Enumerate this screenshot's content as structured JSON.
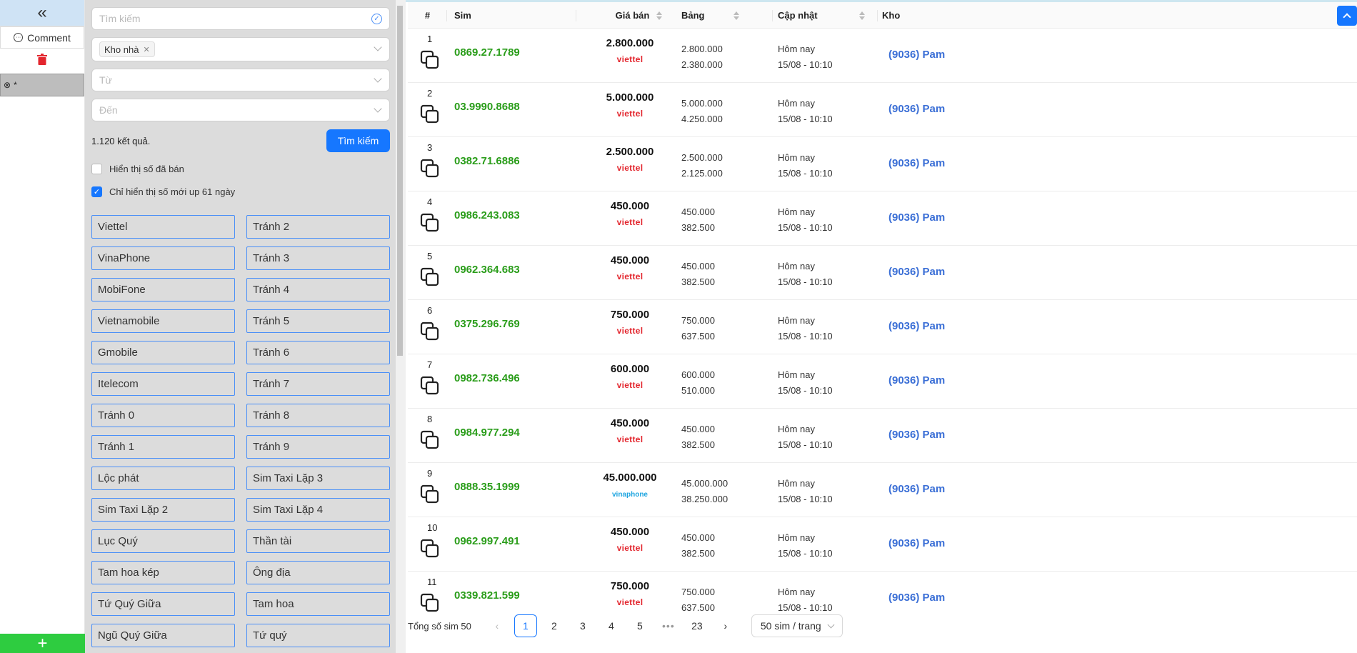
{
  "left_panel": {
    "comment_label": "Comment",
    "tag_label": "*",
    "add_label": "+"
  },
  "filters": {
    "search_placeholder": "Tìm kiếm",
    "warehouse_chip": "Kho nhà",
    "from_placeholder": "Từ",
    "to_placeholder": "Đến",
    "result_count": "1.120 kết quả.",
    "search_button": "Tìm kiếm",
    "show_sold_label": "Hiển thị số đã bán",
    "show_sold_checked": false,
    "show_new_label": "Chỉ hiển thị số mới up 61 ngày",
    "show_new_checked": true,
    "options": [
      "Viettel",
      "Tránh 2",
      "VinaPhone",
      "Tránh 3",
      "MobiFone",
      "Tránh 4",
      "Vietnamobile",
      "Tránh 5",
      "Gmobile",
      "Tránh 6",
      "Itelecom",
      "Tránh 7",
      "Tránh 0",
      "Tránh 8",
      "Tránh 1",
      "Tránh 9",
      "Lộc phát",
      "Sim Taxi Lặp 3",
      "Sim Taxi Lặp 2",
      "Sim Taxi Lặp 4",
      "Lục Quý",
      "Thần tài",
      "Tam hoa kép",
      "Ông địa",
      "Tứ Quý Giữa",
      "Tam hoa",
      "Ngũ Quý Giữa",
      "Tứ quý"
    ]
  },
  "table": {
    "headers": {
      "index": "#",
      "sim": "Sim",
      "price": "Giá bán",
      "board": "Bảng",
      "updated": "Cập nhật",
      "warehouse": "Kho"
    },
    "rows": [
      {
        "index": "1",
        "sim": "0869.27.1789",
        "price": "2.800.000",
        "carrier": "viettel",
        "board1": "2.800.000",
        "board2": "2.380.000",
        "updated1": "Hôm nay",
        "updated2": "15/08 - 10:10",
        "warehouse": "(9036) Pam"
      },
      {
        "index": "2",
        "sim": "03.9990.8688",
        "price": "5.000.000",
        "carrier": "viettel",
        "board1": "5.000.000",
        "board2": "4.250.000",
        "updated1": "Hôm nay",
        "updated2": "15/08 - 10:10",
        "warehouse": "(9036) Pam"
      },
      {
        "index": "3",
        "sim": "0382.71.6886",
        "price": "2.500.000",
        "carrier": "viettel",
        "board1": "2.500.000",
        "board2": "2.125.000",
        "updated1": "Hôm nay",
        "updated2": "15/08 - 10:10",
        "warehouse": "(9036) Pam"
      },
      {
        "index": "4",
        "sim": "0986.243.083",
        "price": "450.000",
        "carrier": "viettel",
        "board1": "450.000",
        "board2": "382.500",
        "updated1": "Hôm nay",
        "updated2": "15/08 - 10:10",
        "warehouse": "(9036) Pam"
      },
      {
        "index": "5",
        "sim": "0962.364.683",
        "price": "450.000",
        "carrier": "viettel",
        "board1": "450.000",
        "board2": "382.500",
        "updated1": "Hôm nay",
        "updated2": "15/08 - 10:10",
        "warehouse": "(9036) Pam"
      },
      {
        "index": "6",
        "sim": "0375.296.769",
        "price": "750.000",
        "carrier": "viettel",
        "board1": "750.000",
        "board2": "637.500",
        "updated1": "Hôm nay",
        "updated2": "15/08 - 10:10",
        "warehouse": "(9036) Pam"
      },
      {
        "index": "7",
        "sim": "0982.736.496",
        "price": "600.000",
        "carrier": "viettel",
        "board1": "600.000",
        "board2": "510.000",
        "updated1": "Hôm nay",
        "updated2": "15/08 - 10:10",
        "warehouse": "(9036) Pam"
      },
      {
        "index": "8",
        "sim": "0984.977.294",
        "price": "450.000",
        "carrier": "viettel",
        "board1": "450.000",
        "board2": "382.500",
        "updated1": "Hôm nay",
        "updated2": "15/08 - 10:10",
        "warehouse": "(9036) Pam"
      },
      {
        "index": "9",
        "sim": "0888.35.1999",
        "price": "45.000.000",
        "carrier": "vinaphone",
        "board1": "45.000.000",
        "board2": "38.250.000",
        "updated1": "Hôm nay",
        "updated2": "15/08 - 10:10",
        "warehouse": "(9036) Pam"
      },
      {
        "index": "10",
        "sim": "0962.997.491",
        "price": "450.000",
        "carrier": "viettel",
        "board1": "450.000",
        "board2": "382.500",
        "updated1": "Hôm nay",
        "updated2": "15/08 - 10:10",
        "warehouse": "(9036) Pam"
      },
      {
        "index": "11",
        "sim": "0339.821.599",
        "price": "750.000",
        "carrier": "viettel",
        "board1": "750.000",
        "board2": "637.500",
        "updated1": "Hôm nay",
        "updated2": "15/08 - 10:10",
        "warehouse": "(9036) Pam"
      }
    ]
  },
  "pagination": {
    "total_label": "Tổng số sim 50",
    "pages": [
      "1",
      "2",
      "3",
      "4",
      "5",
      "•••",
      "23"
    ],
    "current_page": "1",
    "page_size": "50 sim / trang"
  },
  "colors": {
    "accent": "#1677ff",
    "sim_green": "#2a9d1a",
    "viettel_red": "#e3262e",
    "vinaphone_blue": "#1ea5e0",
    "warehouse_blue": "#3b6fd6",
    "add_green": "#2ecc40"
  }
}
